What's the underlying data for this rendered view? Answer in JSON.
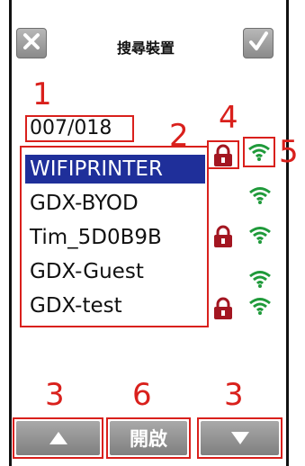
{
  "header": {
    "title": "搜尋裝置",
    "cancel_icon": "close-icon",
    "confirm_icon": "checkmark-icon"
  },
  "annotations": [
    "1",
    "2",
    "3",
    "4",
    "5",
    "6",
    "3"
  ],
  "counter": "007/018",
  "networks": [
    {
      "name": "WIFIPRINTER",
      "selected": true,
      "locked": true
    },
    {
      "name": "GDX-BYOD",
      "selected": false,
      "locked": false
    },
    {
      "name": "Tim_5D0B9B",
      "selected": false,
      "locked": true
    },
    {
      "name": "GDX-Guest",
      "selected": false,
      "locked": false
    },
    {
      "name": "GDX-test",
      "selected": false,
      "locked": true
    }
  ],
  "footer": {
    "up_icon": "triangle-up-icon",
    "open_label": "開啟",
    "down_icon": "triangle-down-icon"
  },
  "colors": {
    "selection": "#1f2f9a",
    "annotation": "#d9201c",
    "lock": "#a31621",
    "wifi": "#1f9a3a"
  }
}
